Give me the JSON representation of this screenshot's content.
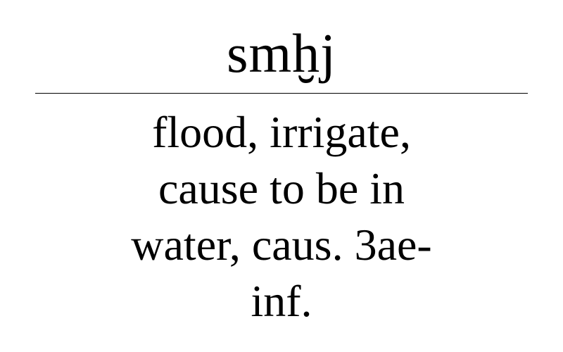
{
  "entry": {
    "headword": "smḫj",
    "definition_lines": [
      "flood, irrigate,",
      "cause to be in",
      "water, caus. 3ae-",
      "inf."
    ]
  }
}
